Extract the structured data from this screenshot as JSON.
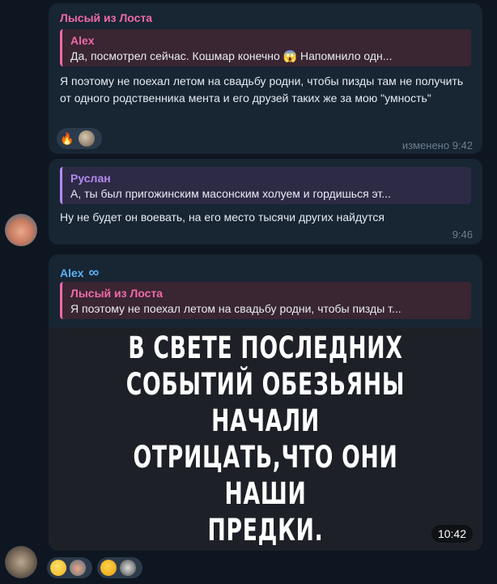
{
  "messages": [
    {
      "sender": "Лысый из Лоста",
      "reply_to": {
        "name": "Alex",
        "text": "Да, посмотрел сейчас. Кошмар конечно 😱 Напомнило одн..."
      },
      "text": "Я поэтому не поехал летом на свадьбу родни, чтобы пизды там не получить от одного родственника мента и его друзей таких же за мою \"умность\"",
      "reactions": [
        "fire",
        "avatar"
      ],
      "time": "изменено 9:42"
    },
    {
      "reply_to": {
        "name": "Руслан",
        "text": "А, ты был пригожинским масонским холуем и гордишься эт..."
      },
      "text": "Ну не будет он воевать, на его место тысячи других найдутся",
      "time": "9:46"
    },
    {
      "sender": "Alex",
      "sender_badge": "∞",
      "reply_to": {
        "name": "Лысый из Лоста",
        "text": "Я поэтому не поехал летом на свадьбу родни, чтобы пизды т..."
      },
      "image_text": [
        "В СВЕТЕ ПОСЛЕДНИХ",
        "СОБЫТИЙ ОБЕЗЬЯНЫ НАЧАЛИ",
        "ОТРИЦАТЬ,ЧТО ОНИ НАШИ",
        "ПРЕДКИ."
      ],
      "time": "10:42"
    }
  ],
  "colors": {
    "pink": "#ee6aa7",
    "purple": "#b38af0",
    "blue": "#5ab1f5",
    "bubble": "#182533",
    "background": "#0e1621"
  }
}
